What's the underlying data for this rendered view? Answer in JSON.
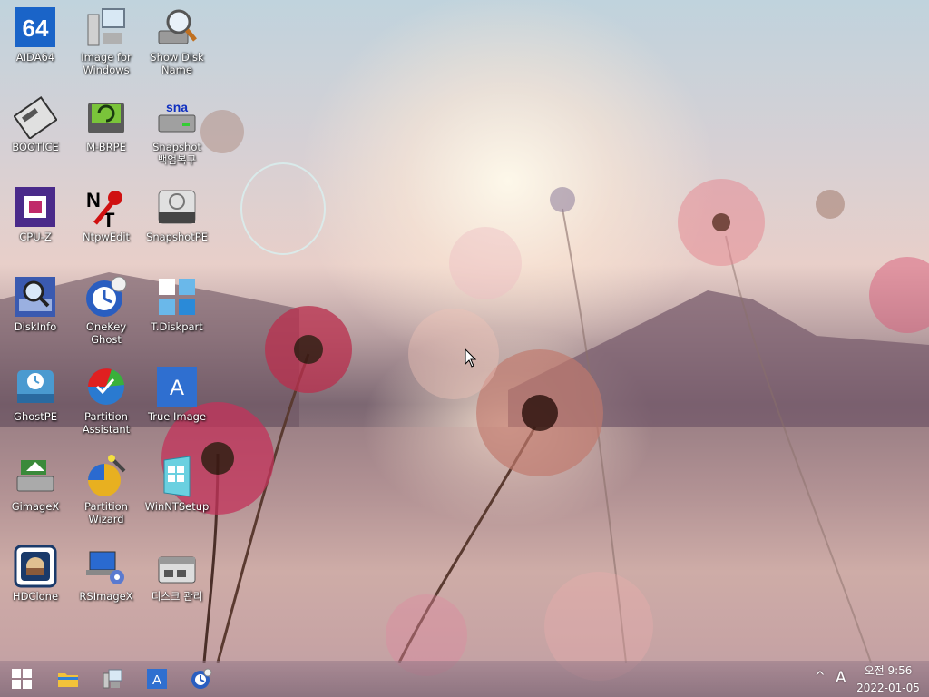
{
  "desktop": {
    "icons": [
      {
        "label": "AIDA64",
        "icon": "aida64-icon"
      },
      {
        "label": "Image for\nWindows",
        "icon": "image-for-windows-icon"
      },
      {
        "label": "Show Disk\nName",
        "icon": "show-disk-name-icon"
      },
      {
        "label": "BOOTICE",
        "icon": "bootice-icon"
      },
      {
        "label": "M-BRPE",
        "icon": "mbrpe-icon"
      },
      {
        "label": "Snapshot\n백업복구",
        "icon": "snapshot-backup-icon"
      },
      {
        "label": "CPU-Z",
        "icon": "cpuz-icon"
      },
      {
        "label": "NtpwEdit",
        "icon": "ntpwedit-icon"
      },
      {
        "label": "SnapshotPE",
        "icon": "snapshotpe-icon"
      },
      {
        "label": "DiskInfo",
        "icon": "diskinfo-icon"
      },
      {
        "label": "OneKey\nGhost",
        "icon": "onekey-ghost-icon"
      },
      {
        "label": "T.Diskpart",
        "icon": "tdiskpart-icon"
      },
      {
        "label": "GhostPE",
        "icon": "ghostpe-icon"
      },
      {
        "label": "Partition\nAssistant",
        "icon": "partition-assistant-icon"
      },
      {
        "label": "True Image",
        "icon": "true-image-icon"
      },
      {
        "label": "GimageX",
        "icon": "gimagex-icon"
      },
      {
        "label": "Partition\nWizard",
        "icon": "partition-wizard-icon"
      },
      {
        "label": "WinNTSetup",
        "icon": "winntsetup-icon"
      },
      {
        "label": "HDClone",
        "icon": "hdclone-icon"
      },
      {
        "label": "RSImageX",
        "icon": "rsimagex-icon"
      },
      {
        "label": "디스크 관리",
        "icon": "disk-management-icon"
      }
    ]
  },
  "taskbar": {
    "pinned": [
      "start-icon",
      "file-explorer-icon",
      "image-for-windows-icon",
      "true-image-icon",
      "onekey-ghost-icon"
    ],
    "tray": {
      "chevron": "^",
      "ime": "A",
      "time": "오전 9:56",
      "date": "2022-01-05"
    }
  },
  "colors": {
    "aida_blue": "#1a64c8",
    "cpuz_purple": "#4a2a8a",
    "true_image_blue": "#2f6fd0"
  }
}
